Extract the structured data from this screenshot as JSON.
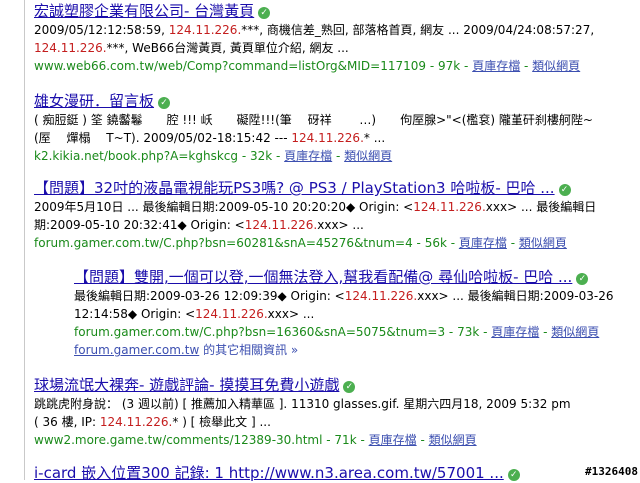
{
  "results": [
    {
      "title": "宏誠塑膠企業有限公司- 台灣黃頁",
      "snippet": [
        {
          "pre": "2009/05/12:12:58:59, ",
          "ip": "124.11.226.",
          "post": "***, 商機信差_熟回, 部落格首頁, 網友 ... 2009/04/24:08:57:27,"
        },
        {
          "pre": "",
          "ip": "124.11.226.",
          "post": "***, WeB66台灣黃頁, 黃頁單位介紹, 網友 ..."
        }
      ],
      "url": "www.web66.com.tw/web/Comp?command=listOrg&MID=117109",
      "size": "97k",
      "cache_label": "頁庫存檔",
      "similar_label": "類似網頁"
    },
    {
      "title": "雄女漫研．留言板",
      "snippet": [
        {
          "pre": "( 痴脰鋌 ) 筌 鐃齾鬈　　腔 !!! 岆　　礙陞!!!(筆　 砑祥　　 …)　　佝厔腺>\"<(檻袞) 隴堇矸刹樓舸陛~",
          "ip": "",
          "post": ""
        },
        {
          "pre": "(厔　 燀榻　 T~T). 2009/05/02-18:15:42 --- ",
          "ip": "124.11.226.",
          "post": "* ..."
        }
      ],
      "url": "k2.kikia.net/book.php?A=kghskcg",
      "size": "32k",
      "cache_label": "頁庫存檔",
      "similar_label": "類似網頁"
    },
    {
      "title": "【問題】32吋的液晶電視能玩PS3嗎? @ PS3 / PlayStation3 哈啦板- 巴哈 ...",
      "snippet": [
        {
          "pre": "2009年5月10日 ... 最後編輯日期:2009-05-10 20:20:20◆ Origin: <",
          "ip": "124.11.226.",
          "post": "xxx> ... 最後編輯日"
        },
        {
          "pre": "期:2009-05-10 20:32:41◆ Origin: <",
          "ip": "124.11.226.",
          "post": "xxx> ..."
        }
      ],
      "url": "forum.gamer.com.tw/C.php?bsn=60281&snA=45276&tnum=4",
      "size": "56k",
      "cache_label": "頁庫存檔",
      "similar_label": "類似網頁"
    },
    {
      "title": "【問題】雙開,一個可以登,一個無法登入,幫我看配備@ 尋仙哈啦板- 巴哈 ...",
      "snippet": [
        {
          "pre": "最後編輯日期:2009-03-26 12:09:39◆ Origin: <",
          "ip": "124.11.226.",
          "post": "xxx> ... 最後編輯日期:2009-03-26"
        },
        {
          "pre": "12:14:58◆ Origin: <",
          "ip": "124.11.226.",
          "post": "xxx> ..."
        }
      ],
      "url": "forum.gamer.com.tw/C.php?bsn=16360&snA=5075&tnum=3",
      "size": "73k",
      "cache_label": "頁庫存檔",
      "similar_label": "類似網頁",
      "more_domain": "forum.gamer.com.tw",
      "more_text": " 的其它相關資訊 »"
    },
    {
      "title": "球場流氓大裸奔- 遊戲評論- 摸摸耳免費小遊戲",
      "snippet": [
        {
          "pre": "跳跳虎附身說： (3 週以前) [ 推薦加入精華區 ]. 11310 glasses.gif. 星期六四月18, 2009 5:32 pm",
          "ip": "",
          "post": ""
        },
        {
          "pre": "( 36 樓, IP: ",
          "ip": "124.11.226.",
          "post": "* ) [ 檢舉此文 ] ..."
        }
      ],
      "url": "www2.more.game.tw/comments/12389-30.html",
      "size": "71k",
      "cache_label": "頁庫存檔",
      "similar_label": "類似網頁"
    },
    {
      "title": "i-card 嵌入位置300 記錄: 1 http://www.n3.area.com.tw/57001 ..."
    }
  ],
  "watermark": "#1326408",
  "colors": {
    "ip": "#c41e1e",
    "url": "#1a8a1a",
    "title": "#1a0dab",
    "link": "#3c4fb0"
  }
}
